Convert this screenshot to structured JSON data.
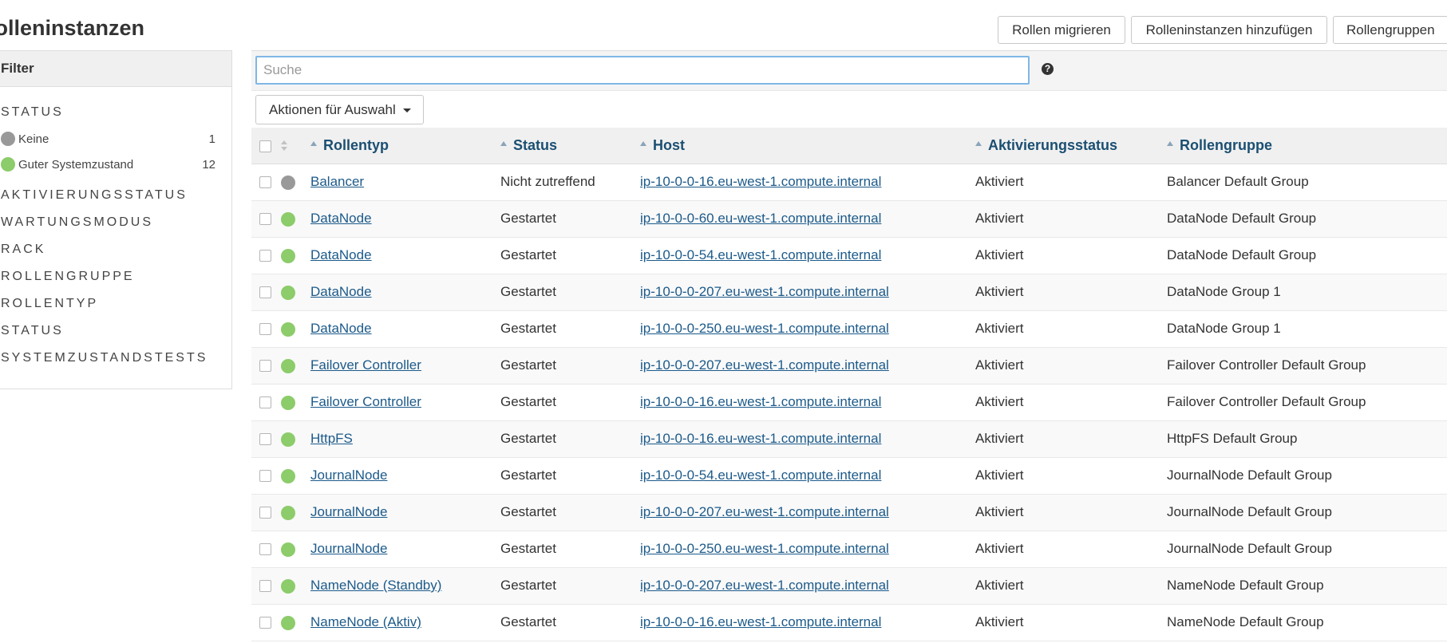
{
  "page": {
    "title": "Rolleninstanzen"
  },
  "header_buttons": {
    "migrate": "Rollen migrieren",
    "add_instances": "Rolleninstanzen hinzufügen",
    "role_groups": "Rollengruppen"
  },
  "sidebar": {
    "header": "Filter",
    "status_title": "STATUS",
    "status_items": [
      {
        "label": "Keine",
        "count": "1",
        "color": "#999999"
      },
      {
        "label": "Guter Systemzustand",
        "count": "12",
        "color": "#8ccc6a"
      }
    ],
    "facets": [
      "AKTIVIERUNGSSTATUS",
      "WARTUNGSMODUS",
      "RACK",
      "ROLLENGRUPPE",
      "ROLLENTYP",
      "STATUS",
      "SYSTEMZUSTANDSTESTS"
    ]
  },
  "search": {
    "placeholder": "Suche",
    "value": ""
  },
  "actions": {
    "label": "Aktionen für Auswahl"
  },
  "table": {
    "columns": [
      "Rollentyp",
      "Status",
      "Host",
      "Aktivierungsstatus",
      "Rollengruppe"
    ],
    "rows": [
      {
        "role": "Balancer",
        "status": "Nicht zutreffend",
        "host": "ip-10-0-0-16.eu-west-1.compute.internal",
        "activation": "Aktiviert",
        "group": "Balancer Default Group",
        "health": "gray"
      },
      {
        "role": "DataNode",
        "status": "Gestartet",
        "host": "ip-10-0-0-60.eu-west-1.compute.internal",
        "activation": "Aktiviert",
        "group": "DataNode Default Group",
        "health": "green"
      },
      {
        "role": "DataNode",
        "status": "Gestartet",
        "host": "ip-10-0-0-54.eu-west-1.compute.internal",
        "activation": "Aktiviert",
        "group": "DataNode Default Group",
        "health": "green"
      },
      {
        "role": "DataNode",
        "status": "Gestartet",
        "host": "ip-10-0-0-207.eu-west-1.compute.internal",
        "activation": "Aktiviert",
        "group": "DataNode Group 1",
        "health": "green"
      },
      {
        "role": "DataNode",
        "status": "Gestartet",
        "host": "ip-10-0-0-250.eu-west-1.compute.internal",
        "activation": "Aktiviert",
        "group": "DataNode Group 1",
        "health": "green"
      },
      {
        "role": "Failover Controller",
        "status": "Gestartet",
        "host": "ip-10-0-0-207.eu-west-1.compute.internal",
        "activation": "Aktiviert",
        "group": "Failover Controller Default Group",
        "health": "green"
      },
      {
        "role": "Failover Controller",
        "status": "Gestartet",
        "host": "ip-10-0-0-16.eu-west-1.compute.internal",
        "activation": "Aktiviert",
        "group": "Failover Controller Default Group",
        "health": "green"
      },
      {
        "role": "HttpFS",
        "status": "Gestartet",
        "host": "ip-10-0-0-16.eu-west-1.compute.internal",
        "activation": "Aktiviert",
        "group": "HttpFS Default Group",
        "health": "green"
      },
      {
        "role": "JournalNode",
        "status": "Gestartet",
        "host": "ip-10-0-0-54.eu-west-1.compute.internal",
        "activation": "Aktiviert",
        "group": "JournalNode Default Group",
        "health": "green"
      },
      {
        "role": "JournalNode",
        "status": "Gestartet",
        "host": "ip-10-0-0-207.eu-west-1.compute.internal",
        "activation": "Aktiviert",
        "group": "JournalNode Default Group",
        "health": "green"
      },
      {
        "role": "JournalNode",
        "status": "Gestartet",
        "host": "ip-10-0-0-250.eu-west-1.compute.internal",
        "activation": "Aktiviert",
        "group": "JournalNode Default Group",
        "health": "green"
      },
      {
        "role": "NameNode (Standby)",
        "status": "Gestartet",
        "host": "ip-10-0-0-207.eu-west-1.compute.internal",
        "activation": "Aktiviert",
        "group": "NameNode Default Group",
        "health": "green"
      },
      {
        "role": "NameNode (Aktiv)",
        "status": "Gestartet",
        "host": "ip-10-0-0-16.eu-west-1.compute.internal",
        "activation": "Aktiviert",
        "group": "NameNode Default Group",
        "health": "green"
      }
    ]
  },
  "colors": {
    "green": "#8ccc6a",
    "gray": "#999999",
    "link": "#1c5a8a",
    "header_text": "#1b4f72"
  }
}
